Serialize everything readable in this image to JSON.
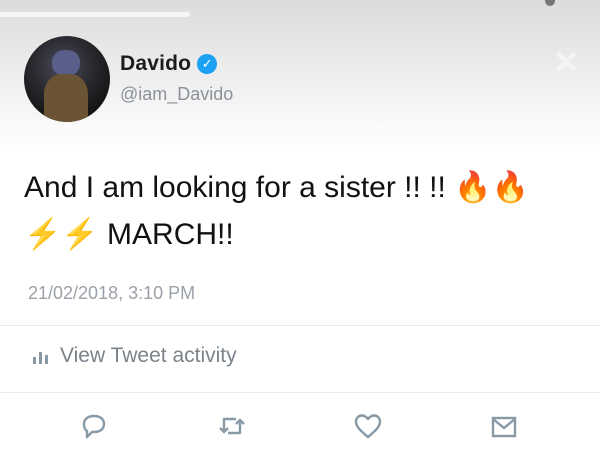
{
  "header": {
    "display_name": "Davido",
    "handle": "@iam_Davido",
    "close_icon": "close-icon"
  },
  "tweet": {
    "line1": "And I am looking for a sister !! !! 🔥🔥",
    "line2": "⚡⚡ MARCH!!",
    "timestamp": "21/02/2018, 3:10 PM"
  },
  "activity": {
    "label": "View Tweet activity",
    "icon": "bar-chart-icon"
  },
  "actions": [
    {
      "name": "reply-button",
      "icon": "reply-icon"
    },
    {
      "name": "retweet-button",
      "icon": "retweet-icon"
    },
    {
      "name": "like-button",
      "icon": "heart-icon"
    },
    {
      "name": "share-button",
      "icon": "share-icon"
    }
  ],
  "colors": {
    "verified": "#1da1f2",
    "muted_text": "#8a9199",
    "icon_gray": "#8899a6"
  }
}
